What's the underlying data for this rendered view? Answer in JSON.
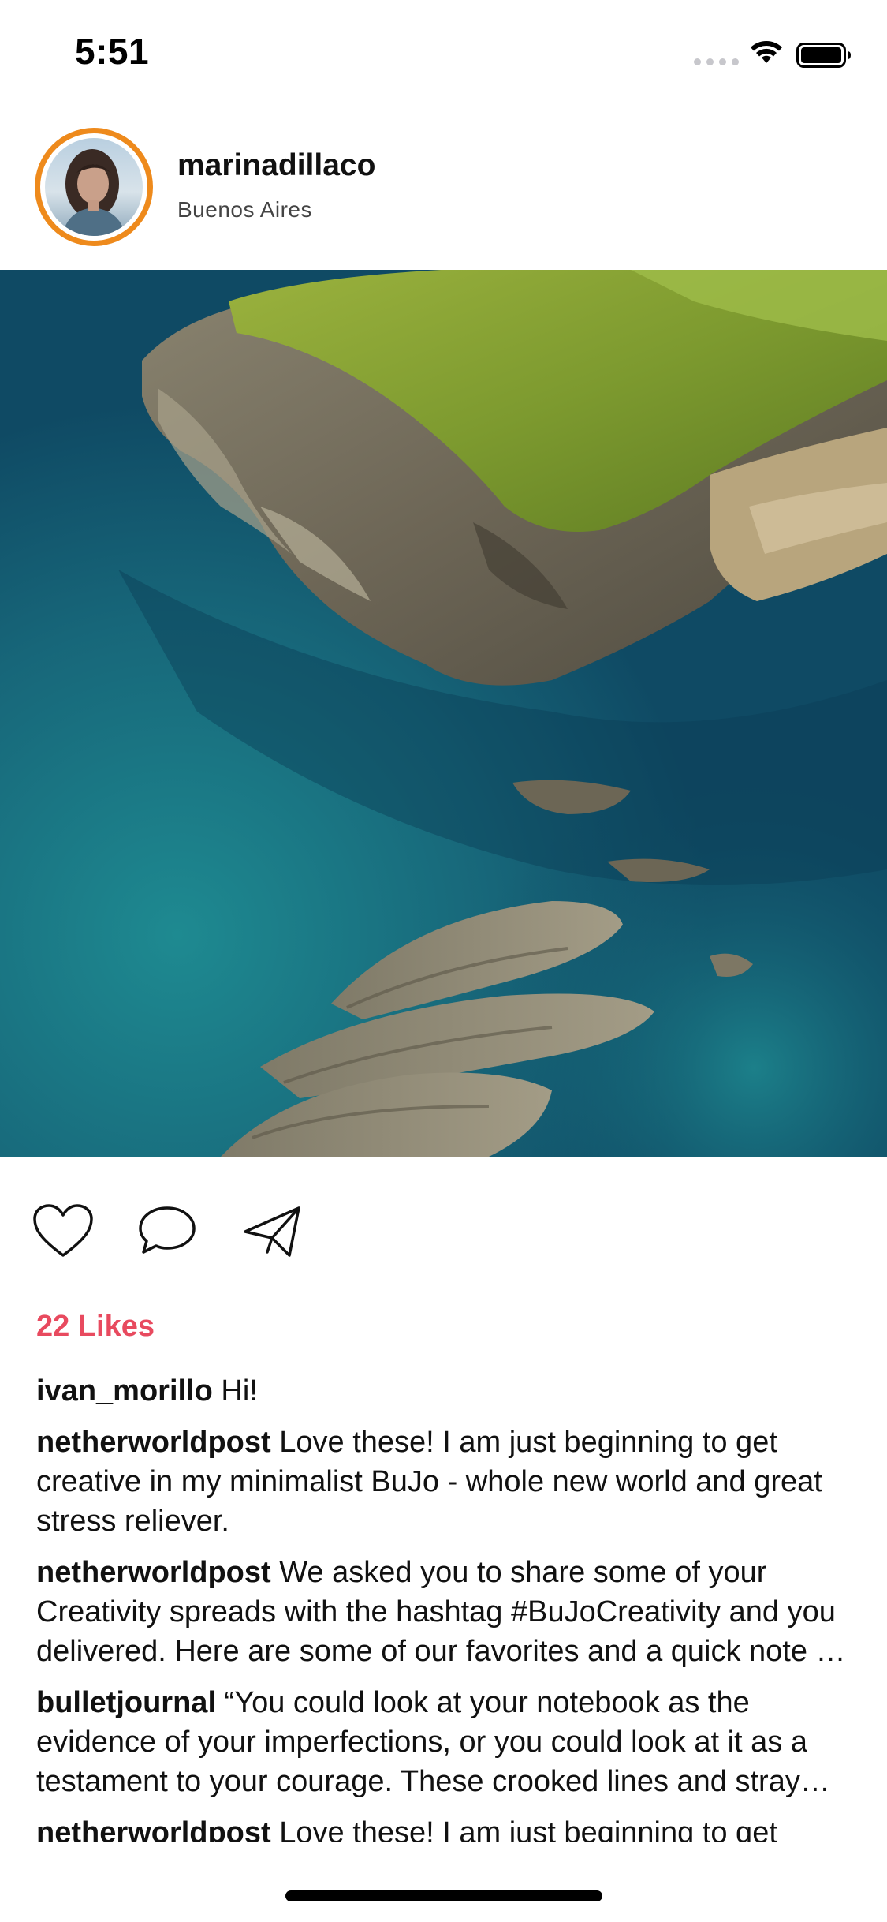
{
  "status_bar": {
    "time": "5:51",
    "icons": [
      "signal-dots-icon",
      "wifi-icon",
      "battery-icon"
    ]
  },
  "post": {
    "username": "marinadillaco",
    "location": "Buenos Aires",
    "avatar_ring_color": "#ee8a1c",
    "image_description_icon": "aerial-coast-photo"
  },
  "actions": {
    "icons": [
      "heart-icon",
      "comment-bubble-icon",
      "paper-plane-icon"
    ]
  },
  "likes": {
    "label": "22 Likes",
    "color": "#e84a5f"
  },
  "comments": [
    {
      "user": "ivan_morillo",
      "text": " Hi!"
    },
    {
      "user": "netherworldpost",
      "text": " Love these! I am just beginning to get creative in my minimalist BuJo - whole new world and great stress reliever."
    },
    {
      "user": "netherworldpost",
      "text": " We asked you to share some of your Creativity spreads with the hashtag #BuJoCreativity and you delivered. Here are some of our favorites and a quick note on how to find them."
    },
    {
      "user": "bulletjournal",
      "text": " “You could look at your notebook as the evidence of your imperfections, or you could look at it as a testament to your courage. These crooked lines and stray marks show you kept going.”"
    },
    {
      "user": "netherworldpost",
      "text": " Love these! I am just beginning to get creative in my minimalist BuJo - whole new world and great stress reliever."
    }
  ]
}
